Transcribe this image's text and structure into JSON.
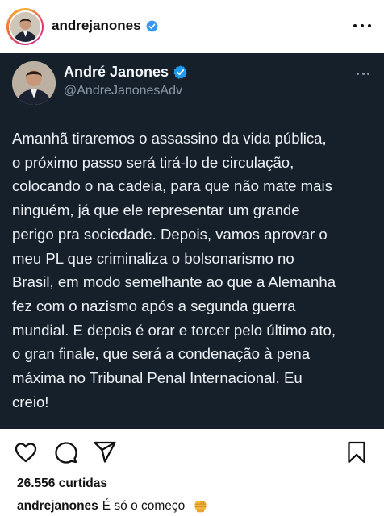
{
  "post": {
    "username": "andrejanones",
    "more_icon": "more-horizontal-icon",
    "verified_color": "#3897f0"
  },
  "tweet": {
    "author_name": "André Janones",
    "author_handle": "@AndreJanonesAdv",
    "verified_color": "#1d9bf0",
    "background": "#15202b",
    "text": "Amanhã tiraremos o assassino da vida pública,\no próximo passo será tirá-lo de circulação,\ncolocando o na cadeia, para que não mate mais\nninguém, já que ele representar um grande\nperigo pra sociedade. Depois, vamos aprovar o\nmeu PL que criminaliza o bolsonarismo no\nBrasil, em modo semelhante ao que a Alemanha\nfez com o nazismo após a segunda guerra\nmundial. E depois é orar e torcer pelo último ato,\no gran finale, que será a condenação à pena\nmáxima no Tribunal Penal Internacional. Eu\ncreio!"
  },
  "actions": {
    "like_icon": "heart-icon",
    "comment_icon": "comment-icon",
    "share_icon": "send-icon",
    "save_icon": "bookmark-icon"
  },
  "likes": {
    "text": "26.556 curtidas"
  },
  "caption": {
    "username": "andrejanones",
    "text": "É só o começo",
    "emoji_icon": "oncoming-fist-icon"
  }
}
